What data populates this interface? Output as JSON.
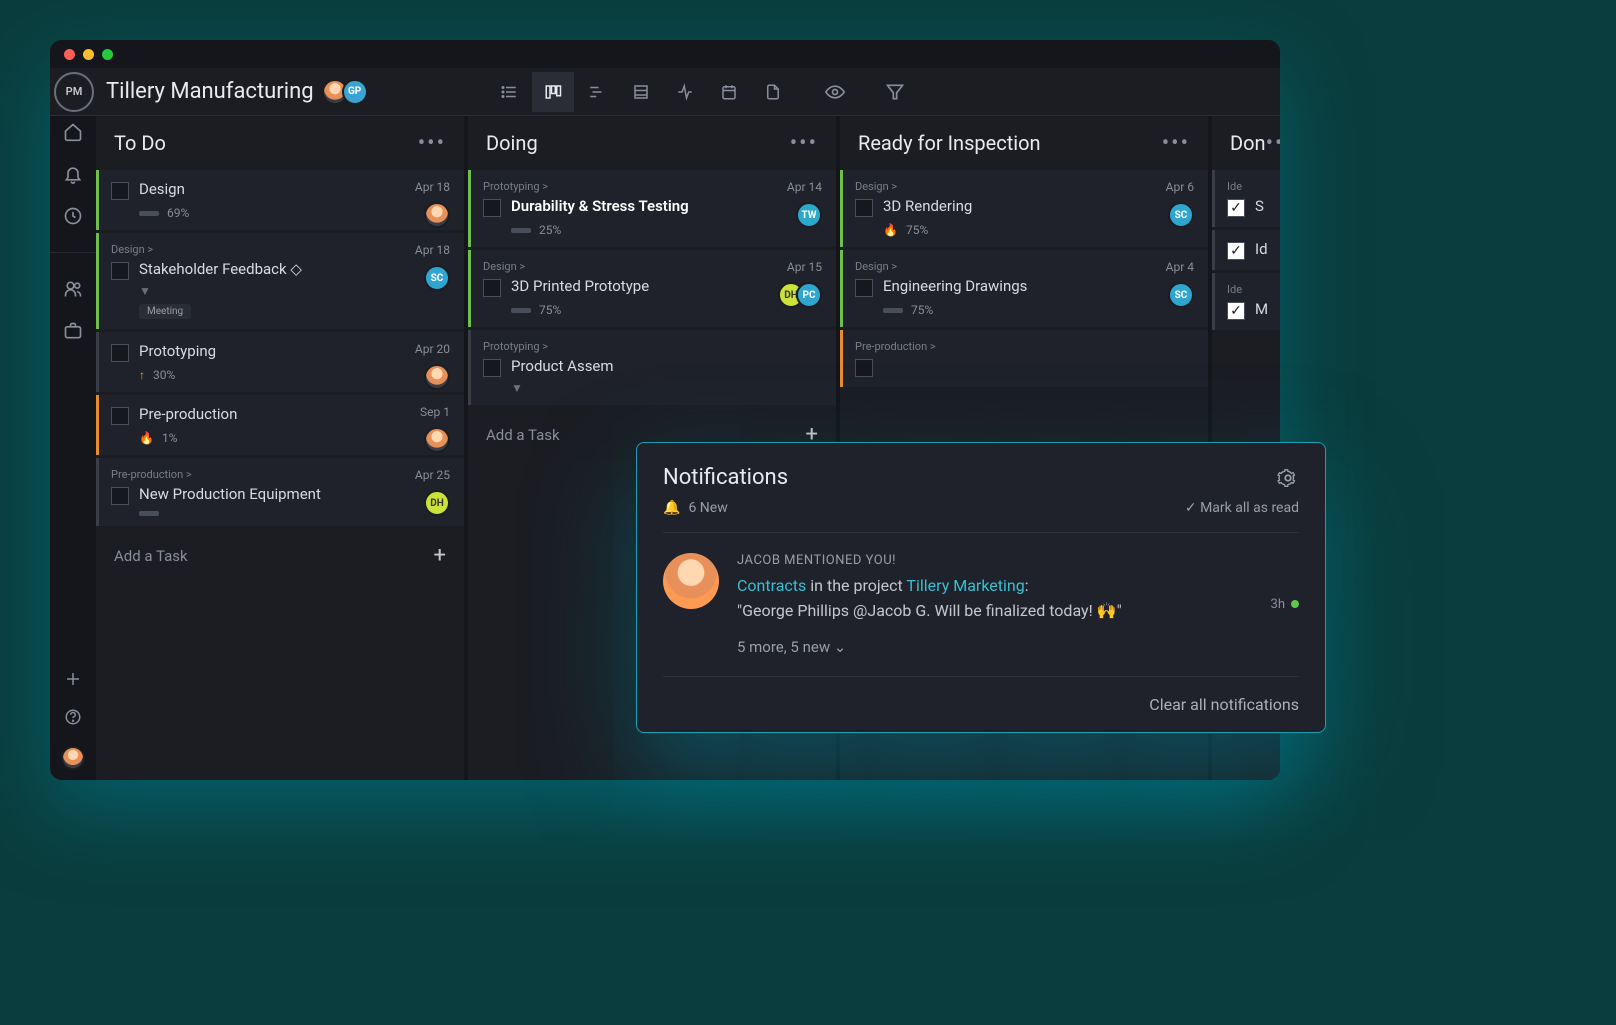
{
  "logo_text": "PM",
  "project_title": "Tillery Manufacturing",
  "header_avatars": [
    {
      "id": "cartoon"
    },
    {
      "id": "gp",
      "label": "GP"
    }
  ],
  "columns": [
    {
      "title": "To Do",
      "cards": [
        {
          "title": "Design",
          "date": "Apr 18",
          "progress": "69%",
          "avatar": "cartoon",
          "border": "green"
        },
        {
          "breadcrumb": "Design >",
          "title": "Stakeholder Feedback ◇",
          "date": "Apr 18",
          "avatar": "sc",
          "avatar_label": "SC",
          "border": "green",
          "tag": "Meeting",
          "chev": true
        },
        {
          "title": "Prototyping",
          "date": "Apr 20",
          "progress": "30%",
          "icon": "↑",
          "iconColor": "#e8a34a",
          "avatar": "cartoon",
          "border": "default"
        },
        {
          "title": "Pre-production",
          "date": "Sep 1",
          "progress": "1%",
          "icon": "🔥",
          "avatar": "cartoon",
          "border": "orange"
        },
        {
          "breadcrumb": "Pre-production >",
          "title": "New Production Equipment",
          "date": "Apr 25",
          "avatar": "dh",
          "avatar_label": "DH",
          "border": "default",
          "bar": true
        }
      ],
      "add": "Add a Task"
    },
    {
      "title": "Doing",
      "cards": [
        {
          "breadcrumb": "Prototyping >",
          "title": "Durability & Stress Testing",
          "bold": true,
          "date": "Apr 14",
          "progress": "25%",
          "avatar": "tw",
          "avatar_label": "TW",
          "border": "green"
        },
        {
          "breadcrumb": "Design >",
          "title": "3D Printed Prototype",
          "date": "Apr 15",
          "progress": "75%",
          "avatars": [
            "dh",
            "pc"
          ],
          "border": "green"
        },
        {
          "breadcrumb": "Prototyping >",
          "title": "Product Assem",
          "date": "",
          "border": "default",
          "chev": true
        }
      ],
      "add": "Add a Task"
    },
    {
      "title": "Ready for Inspection",
      "cards": [
        {
          "breadcrumb": "Design >",
          "title": "3D Rendering",
          "date": "Apr 6",
          "progress": "75%",
          "icon": "🔥",
          "avatar": "sc",
          "avatar_label": "SC",
          "border": "green"
        },
        {
          "breadcrumb": "Design >",
          "title": "Engineering Drawings",
          "date": "Apr 4",
          "progress": "75%",
          "avatar": "sc",
          "avatar_label": "SC",
          "border": "green"
        },
        {
          "breadcrumb": "Pre-production >",
          "title": "",
          "border": "orange"
        }
      ]
    },
    {
      "title": "Don",
      "narrow": true,
      "cards": [
        {
          "breadcrumb": "Ide",
          "checked": true,
          "title": "S"
        },
        {
          "checked": true,
          "title": "Id"
        },
        {
          "breadcrumb": "Ide",
          "checked": true,
          "title": "M"
        }
      ]
    }
  ],
  "notif": {
    "title": "Notifications",
    "count": "6 New",
    "mark_all": "Mark all as read",
    "mention": "JACOB MENTIONED YOU!",
    "link1": "Contracts",
    "mid": " in the project ",
    "link2": "Tillery Marketing",
    "after": ":",
    "body": "\"George Phillips @Jacob G. Will be finalized today! 🙌\"",
    "more": "5 more, 5 new ⌄",
    "time": "3h",
    "clear": "Clear all notifications"
  }
}
